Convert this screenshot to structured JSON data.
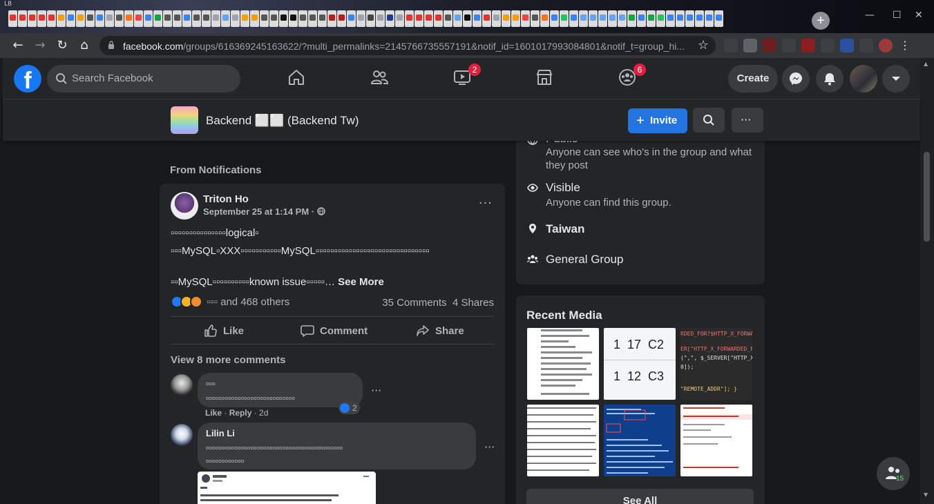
{
  "browser": {
    "corner_label": "LB",
    "url_host": "facebook.com",
    "url_path": "/groups/616369245163622/?multi_permalinks=2145766735557191&notif_id=1601017993084801&notif_t=group_hi...",
    "tab_colors": [
      "#e3342f",
      "#e3342f",
      "#e3342f",
      "#e3342f",
      "#e3342f",
      "#f59e0b",
      "#3b82f6",
      "#f59e0b",
      "#555555",
      "#3b82f6",
      "#9ca3af",
      "#555555",
      "#f97316",
      "#ef4444",
      "#3b82f6",
      "#16a34a",
      "#555555",
      "#555555",
      "#3b82f6",
      "#555555",
      "#555555",
      "#9ca3af",
      "#60a5fa",
      "#9ca3af",
      "#f59e0b",
      "#f59e0b",
      "#555555",
      "#555555",
      "#111111",
      "#111111",
      "#555555",
      "#555555",
      "#555555",
      "#b91c1c",
      "#b91c1c",
      "#3b82f6",
      "#9ca3af",
      "#444444",
      "#9ca3af",
      "#1e3a8a",
      "#9ca3af",
      "#e3342f",
      "#e3342f",
      "#e3342f",
      "#e3342f",
      "#555555",
      "#60a5fa",
      "#111111",
      "#3b82f6",
      "#e3342f",
      "#9ca3af",
      "#f59e0b",
      "#f59e0b",
      "#ef4444",
      "#555555",
      "#f97316",
      "#3b82f6",
      "#22c55e",
      "#3b82f6",
      "#60a5fa",
      "#60a5fa",
      "#60a5fa",
      "#60a5fa",
      "#60a5fa",
      "#16a34a",
      "#3b82f6",
      "#16a34a",
      "#22c55e",
      "#3b82f6",
      "#3b82f6",
      "#3b82f6",
      "#3b82f6",
      "#3b82f6",
      "#3b82f6"
    ]
  },
  "header": {
    "logo": "f",
    "search_placeholder": "Search Facebook",
    "watch_badge": "2",
    "groups_badge": "6",
    "create_label": "Create"
  },
  "group": {
    "name": "Backend ⬜⬜ (Backend Tw)",
    "invite_label": "Invite",
    "invite_plus": "+"
  },
  "feed": {
    "section_heading": "From Notifications",
    "post": {
      "author": "Triton Ho",
      "time": "September 25 at 1:14 PM · ",
      "more": "···",
      "line1": "▫▫▫▫▫▫▫▫▫▫▫▫▫▫▫logical▫",
      "line2": "▫▫▫MySQL▫XXX▫▫▫▫▫▫▫▫▫▫▫MySQL▫▫▫▫▫▫▫▫▫▫▫▫▫▫▫▫▫▫▫▫▫▫▫▫▫▫▫▫▫▫▫",
      "line3": "▫▫MySQL▫▫▫▫▫▫▫▫▫▫known issue▫▫▫▫▫… ",
      "see_more": "See More",
      "reactions_text": "▫▫▫ and 468 others",
      "comments_count": "35 Comments",
      "shares_count": "4 Shares",
      "like_label": "Like",
      "comment_label": "Comment",
      "share_label": "Share",
      "view_more_comments": "View 8 more comments",
      "comments": [
        {
          "name": "▫▫▫",
          "text": "▫▫▫▫▫▫▫▫▫▫▫▫▫▫▫▫▫▫▫▫▫▫▫▫▫▫▫▫",
          "like": "Like",
          "reply": "Reply",
          "age": "2d",
          "likes": "2"
        },
        {
          "name": "Lilin Li",
          "text_line1": "▫▫▫▫▫▫▫▫▫▫▫▫▫▫▫▫▫▫▫▫▫▫▫▫▫▫▫▫▫▫▫▫▫▫▫▫▫▫▫▫▫▫▫",
          "text_line2": "▫▫▫▫▫▫▫▫▫▫▫▫"
        }
      ]
    }
  },
  "about": {
    "public_title": "Public",
    "public_desc": "Anyone can see who's in the group and what they post",
    "visible_title": "Visible",
    "visible_desc": "Anyone can find this group.",
    "location": "Taiwan",
    "group_type": "General Group"
  },
  "media": {
    "title": "Recent Media",
    "see_all": "See All",
    "thumb2_row1": "1  17  C2",
    "thumb2_row2": "1  12  C3",
    "thumb3_line1": "RDED_FOR?$HTTP_X_FORWAR",
    "thumb3_line2": "ER[\"HTTP_X_FORWARDED_FO",
    "thumb3_line3": "(\",\", $_SERVER[\"HTTP_X_",
    "thumb3_line4": "0]);",
    "thumb3_line5": "\"REMOTE_ADDR\"]; }"
  },
  "chat": {
    "count": "15"
  }
}
